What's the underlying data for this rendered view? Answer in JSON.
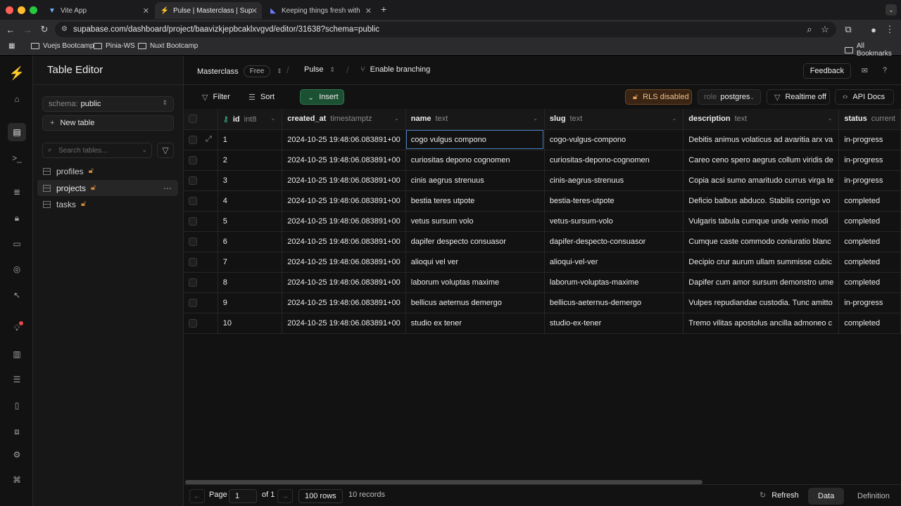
{
  "browser": {
    "tabs": [
      {
        "title": "Vite App",
        "active": false
      },
      {
        "title": "Pulse | Masterclass | Supabase",
        "active": true
      },
      {
        "title": "Keeping things fresh with sta",
        "active": false
      }
    ],
    "url": "supabase.com/dashboard/project/baavizkjepbcaklxvgvd/editor/31638?schema=public",
    "bookmarks": [
      "Vuejs Bootcamp",
      "Pinia-WS",
      "Nuxt Bootcamp"
    ],
    "all_bookmarks": "All Bookmarks"
  },
  "sidebar": {
    "title": "Table Editor",
    "schema_label": "schema:",
    "schema_value": "public",
    "new_table": "New table",
    "search_placeholder": "Search tables...",
    "tables": [
      {
        "name": "profiles",
        "active": false
      },
      {
        "name": "projects",
        "active": true
      },
      {
        "name": "tasks",
        "active": false
      }
    ]
  },
  "topbar": {
    "org": "Masterclass",
    "plan": "Free",
    "project": "Pulse",
    "branching": "Enable branching",
    "feedback": "Feedback"
  },
  "toolbar": {
    "filter": "Filter",
    "sort": "Sort",
    "insert": "Insert",
    "rls": "RLS disabled",
    "role_label": "role",
    "role_value": "postgres",
    "realtime": "Realtime off",
    "api_docs": "API Docs"
  },
  "grid": {
    "columns": [
      {
        "name": "id",
        "type": "int8"
      },
      {
        "name": "created_at",
        "type": "timestamptz"
      },
      {
        "name": "name",
        "type": "text"
      },
      {
        "name": "slug",
        "type": "text"
      },
      {
        "name": "description",
        "type": "text"
      },
      {
        "name": "status",
        "type": "current"
      }
    ],
    "rows": [
      [
        "1",
        "2024-10-25 19:48:06.083891+00",
        "cogo vulgus compono",
        "cogo-vulgus-compono",
        "Debitis animus volaticus ad avaritia arx va",
        "in-progress"
      ],
      [
        "2",
        "2024-10-25 19:48:06.083891+00",
        "curiositas depono cognomen",
        "curiositas-depono-cognomen",
        "Careo ceno spero aegrus collum viridis de",
        "in-progress"
      ],
      [
        "3",
        "2024-10-25 19:48:06.083891+00",
        "cinis aegrus strenuus",
        "cinis-aegrus-strenuus",
        "Copia acsi sumo amaritudo currus virga te",
        "in-progress"
      ],
      [
        "4",
        "2024-10-25 19:48:06.083891+00",
        "bestia teres utpote",
        "bestia-teres-utpote",
        "Deficio balbus abduco. Stabilis corrigo vo",
        "completed"
      ],
      [
        "5",
        "2024-10-25 19:48:06.083891+00",
        "vetus sursum volo",
        "vetus-sursum-volo",
        "Vulgaris tabula cumque unde venio modi",
        "completed"
      ],
      [
        "6",
        "2024-10-25 19:48:06.083891+00",
        "dapifer despecto consuasor",
        "dapifer-despecto-consuasor",
        "Cumque caste commodo coniuratio blanc",
        "completed"
      ],
      [
        "7",
        "2024-10-25 19:48:06.083891+00",
        "alioqui vel ver",
        "alioqui-vel-ver",
        "Decipio crur aurum ullam summisse cubic",
        "completed"
      ],
      [
        "8",
        "2024-10-25 19:48:06.083891+00",
        "laborum voluptas maxime",
        "laborum-voluptas-maxime",
        "Dapifer cum amor sursum demonstro ume",
        "completed"
      ],
      [
        "9",
        "2024-10-25 19:48:06.083891+00",
        "bellicus aeternus demergo",
        "bellicus-aeternus-demergo",
        "Vulpes repudiandae custodia. Tunc amitto",
        "in-progress"
      ],
      [
        "10",
        "2024-10-25 19:48:06.083891+00",
        "studio ex tener",
        "studio-ex-tener",
        "Tremo vilitas apostolus ancilla admoneo c",
        "completed"
      ]
    ]
  },
  "footer": {
    "page_label": "Page",
    "page_value": "1",
    "of_label": "of 1",
    "rows": "100 rows",
    "records": "10 records",
    "refresh": "Refresh",
    "data_tab": "Data",
    "definition_tab": "Definition"
  },
  "colors": {
    "brand": "#3ecf8e",
    "insert_bg": "#1c5033",
    "rls_bg": "#3a2514",
    "selection": "#4c7fc1"
  }
}
